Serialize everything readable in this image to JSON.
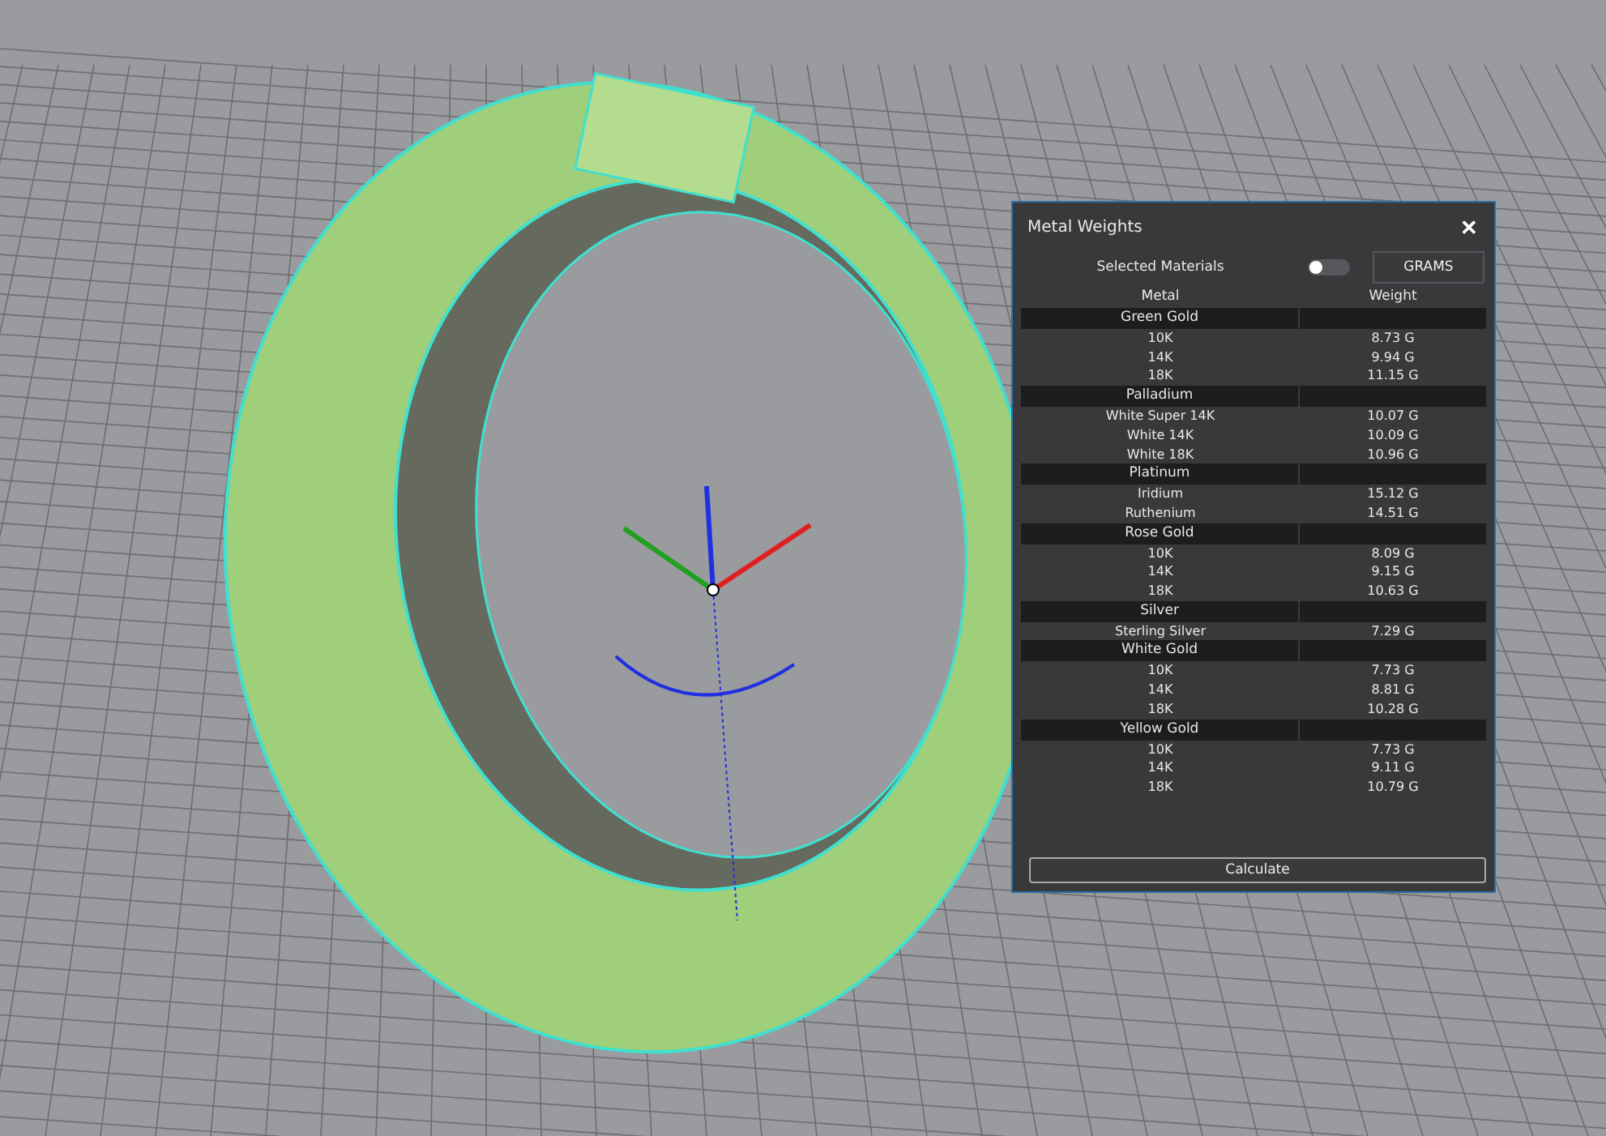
{
  "dialog": {
    "title": "Metal Weights",
    "close": "✕",
    "filter_label": "Selected Materials",
    "filter_toggle": {
      "on": false
    },
    "unit_button": "GRAMS",
    "table": {
      "columns": [
        "Metal",
        "Weight"
      ],
      "groups": [
        {
          "name": "Green Gold",
          "rows": [
            {
              "metal": "10K",
              "weight": "8.73 G"
            },
            {
              "metal": "14K",
              "weight": "9.94 G"
            },
            {
              "metal": "18K",
              "weight": "11.15 G"
            }
          ]
        },
        {
          "name": "Palladium",
          "rows": [
            {
              "metal": "White Super 14K",
              "weight": "10.07 G"
            },
            {
              "metal": "White 14K",
              "weight": "10.09 G"
            },
            {
              "metal": "White 18K",
              "weight": "10.96 G"
            }
          ]
        },
        {
          "name": "Platinum",
          "rows": [
            {
              "metal": "Iridium",
              "weight": "15.12 G"
            },
            {
              "metal": "Ruthenium",
              "weight": "14.51 G"
            }
          ]
        },
        {
          "name": "Rose Gold",
          "rows": [
            {
              "metal": "10K",
              "weight": "8.09 G"
            },
            {
              "metal": "14K",
              "weight": "9.15 G"
            },
            {
              "metal": "18K",
              "weight": "10.63 G"
            }
          ]
        },
        {
          "name": "Silver",
          "rows": [
            {
              "metal": "Sterling Silver",
              "weight": "7.29 G"
            }
          ]
        },
        {
          "name": "White Gold",
          "rows": [
            {
              "metal": "10K",
              "weight": "7.73 G"
            },
            {
              "metal": "14K",
              "weight": "8.81 G"
            },
            {
              "metal": "18K",
              "weight": "10.28 G"
            }
          ]
        },
        {
          "name": "Yellow Gold",
          "rows": [
            {
              "metal": "10K",
              "weight": "7.73 G"
            },
            {
              "metal": "14K",
              "weight": "9.11 G"
            },
            {
              "metal": "18K",
              "weight": "10.79 G"
            }
          ]
        }
      ]
    },
    "action_button": "Calculate"
  }
}
